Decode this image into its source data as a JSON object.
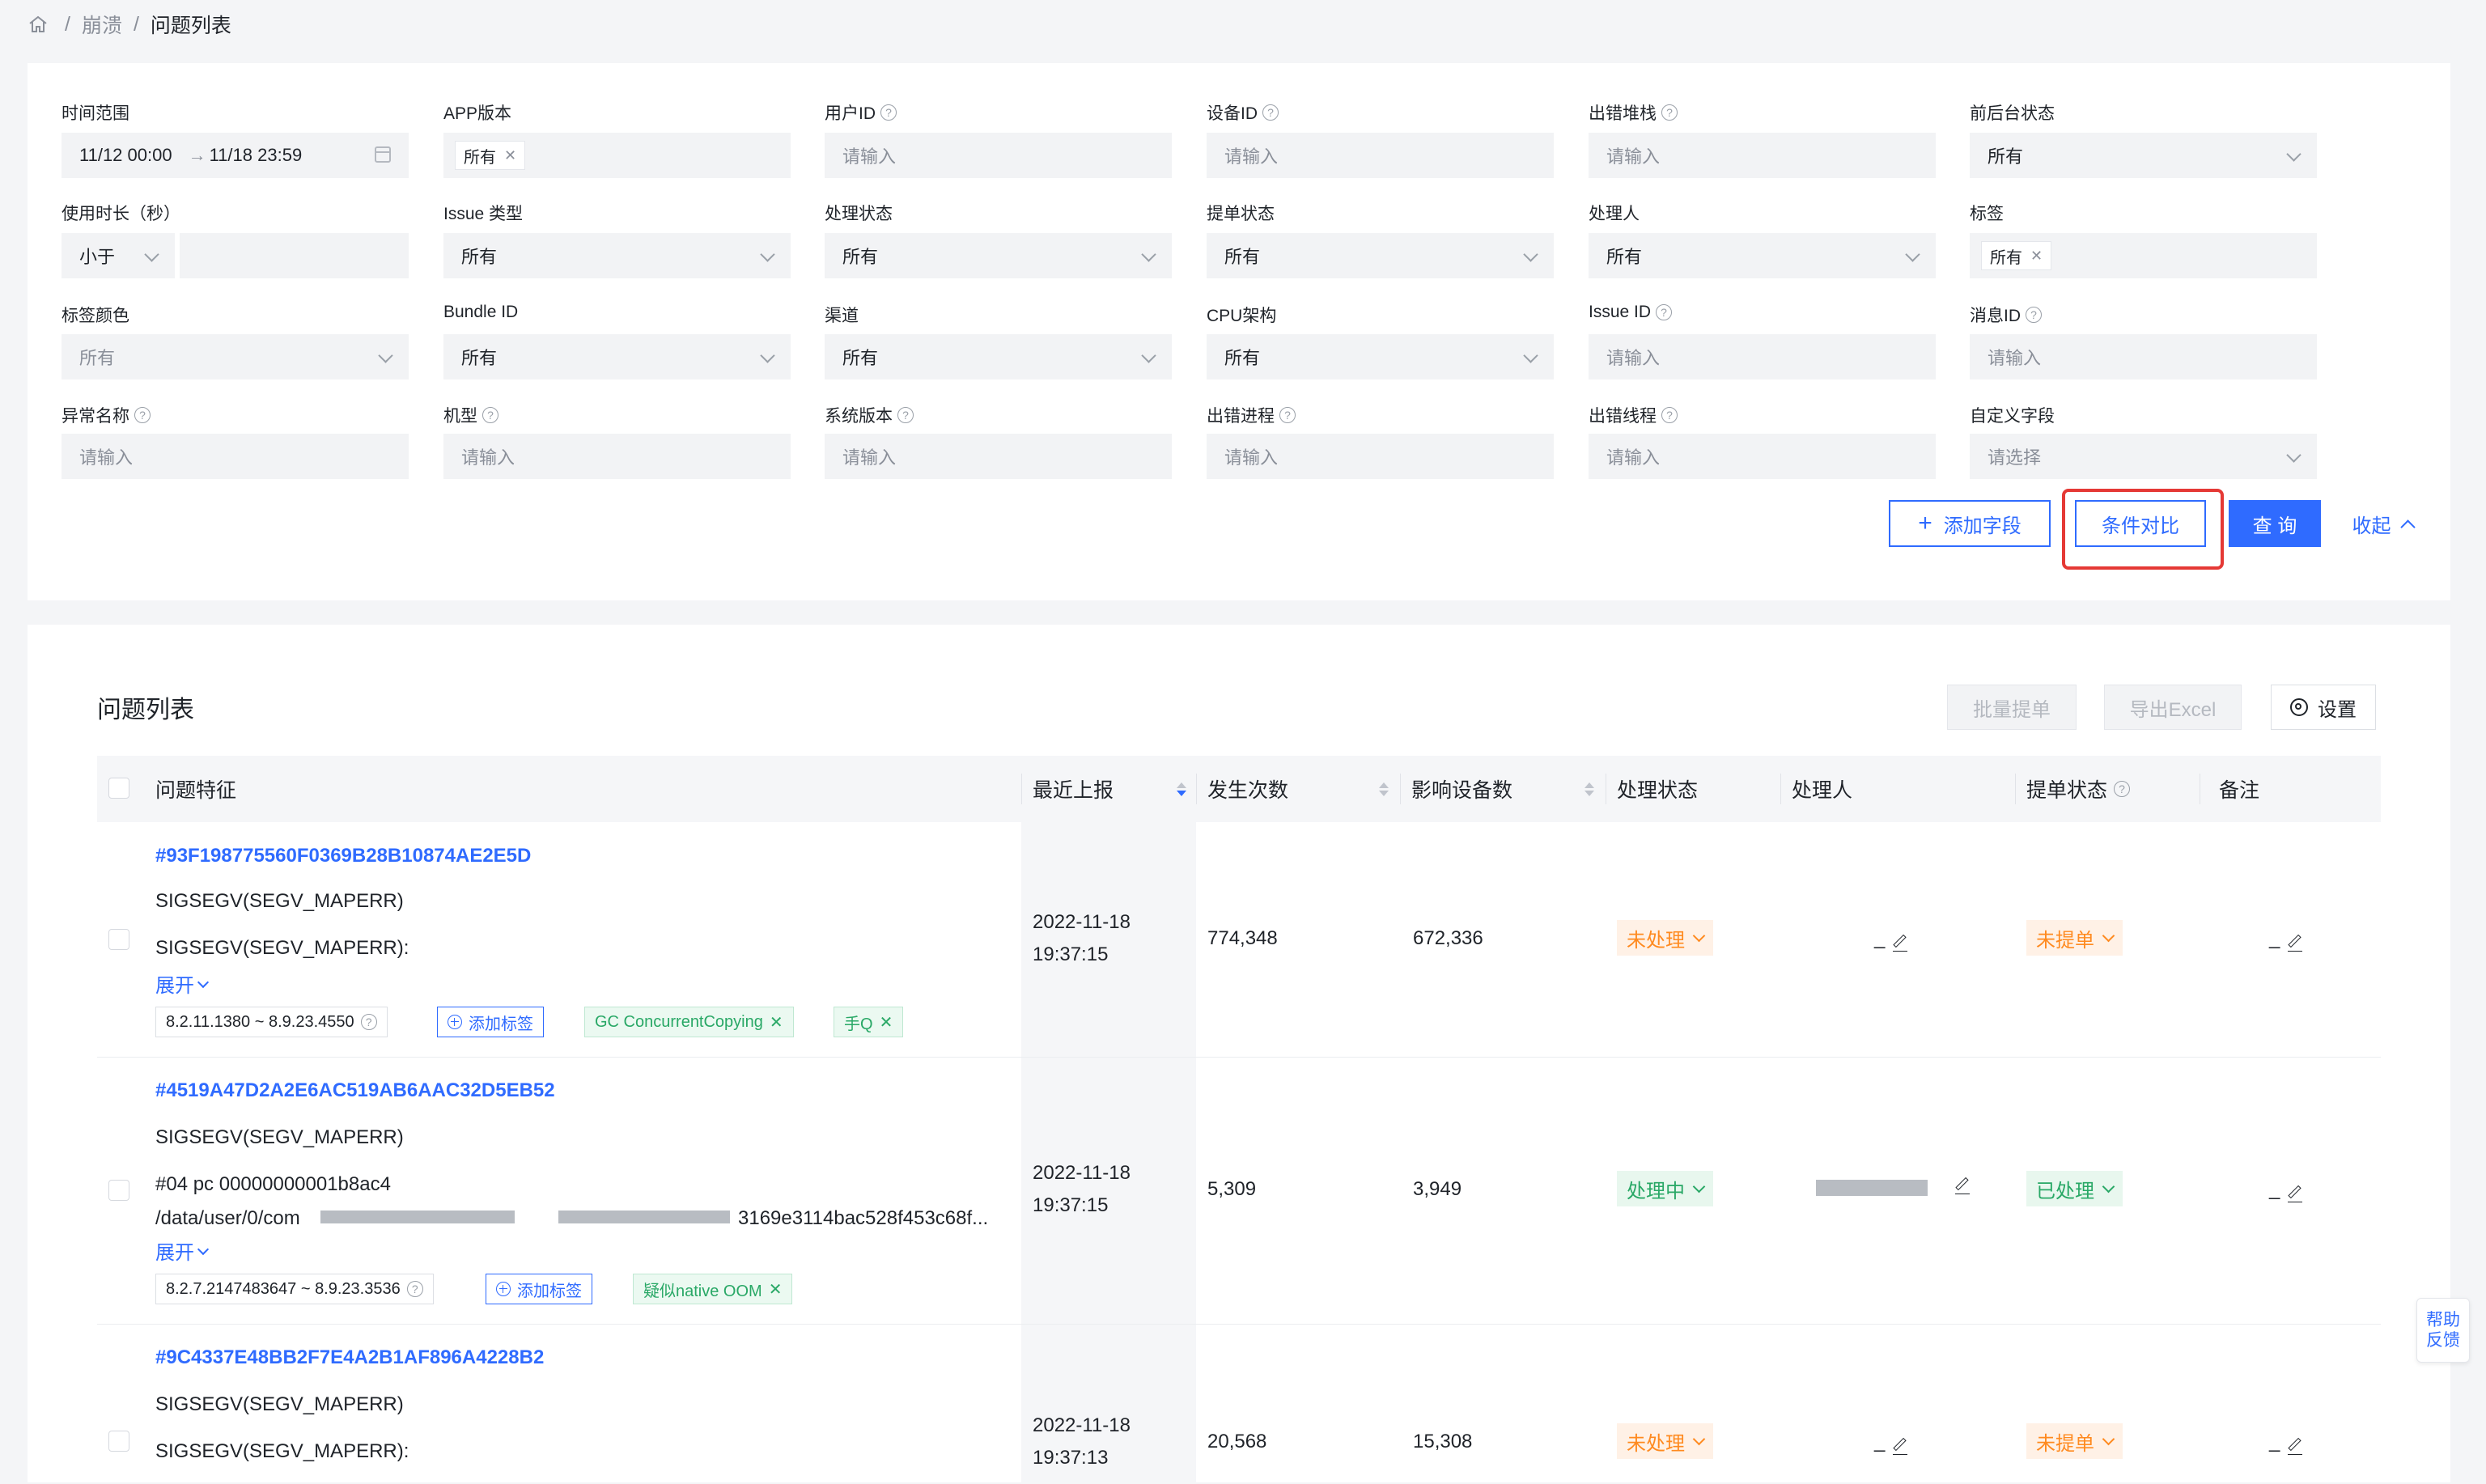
{
  "breadcrumb": {
    "home_icon": "home-icon",
    "items": [
      "崩溃",
      "问题列表"
    ],
    "separator": "/"
  },
  "filters": {
    "time_range": {
      "label": "时间范围",
      "start": "11/12 00:00",
      "arrow": "→",
      "end": "11/18 23:59"
    },
    "app_version": {
      "label": "APP版本",
      "tag": "所有"
    },
    "user_id": {
      "label": "用户ID",
      "placeholder": "请输入"
    },
    "device_id": {
      "label": "设备ID",
      "placeholder": "请输入"
    },
    "error_stack": {
      "label": "出错堆栈",
      "placeholder": "请输入"
    },
    "fg_bg_state": {
      "label": "前后台状态",
      "value": "所有"
    },
    "duration": {
      "label": "使用时长（秒）",
      "operator": "小于"
    },
    "issue_type": {
      "label": "Issue 类型",
      "value": "所有"
    },
    "process_status": {
      "label": "处理状态",
      "value": "所有"
    },
    "ticket_status": {
      "label": "提单状态",
      "value": "所有"
    },
    "handler": {
      "label": "处理人",
      "value": "所有"
    },
    "tags": {
      "label": "标签",
      "tag": "所有"
    },
    "tag_color": {
      "label": "标签颜色",
      "value": "所有"
    },
    "bundle_id": {
      "label": "Bundle ID",
      "value": "所有"
    },
    "channel": {
      "label": "渠道",
      "value": "所有"
    },
    "cpu_arch": {
      "label": "CPU架构",
      "value": "所有"
    },
    "issue_id": {
      "label": "Issue ID",
      "placeholder": "请输入"
    },
    "message_id": {
      "label": "消息ID",
      "placeholder": "请输入"
    },
    "exception_name": {
      "label": "异常名称",
      "placeholder": "请输入"
    },
    "device_model": {
      "label": "机型",
      "placeholder": "请输入"
    },
    "os_version": {
      "label": "系统版本",
      "placeholder": "请输入"
    },
    "error_process": {
      "label": "出错进程",
      "placeholder": "请输入"
    },
    "error_thread": {
      "label": "出错线程",
      "placeholder": "请输入"
    },
    "custom_field": {
      "label": "自定义字段",
      "placeholder": "请选择"
    }
  },
  "filter_actions": {
    "add_field": "添加字段",
    "compare": "条件对比",
    "query": "查 询",
    "collapse": "收起"
  },
  "list": {
    "title": "问题列表",
    "batch_ticket": "批量提单",
    "export_excel": "导出Excel",
    "settings": "设置",
    "columns": [
      "问题特征",
      "最近上报",
      "发生次数",
      "影响设备数",
      "处理状态",
      "处理人",
      "提单状态",
      "备注"
    ],
    "expand_label": "展开",
    "add_tag_label": "添加标签",
    "rows": [
      {
        "issue_id": "#93F198775560F0369B28B10874AE2E5D",
        "title": "SIGSEGV(SEGV_MAPERR)",
        "detail1": "SIGSEGV(SEGV_MAPERR):",
        "detail2": "",
        "version_range": "8.2.11.1380 ~ 8.9.23.4550",
        "tags": [
          "GC ConcurrentCopying",
          "手Q"
        ],
        "last_report_date": "2022-11-18",
        "last_report_time": "19:37:15",
        "occurrences": "774,348",
        "affected_devices": "672,336",
        "process_status": "未处理",
        "handler": "_",
        "ticket_status": "未提单",
        "note": "_"
      },
      {
        "issue_id": "#4519A47D2A2E6AC519AB6AAC32D5EB52",
        "title": "SIGSEGV(SEGV_MAPERR)",
        "detail1": "#04 pc 00000000001b8ac4",
        "detail2": "/data/user/0/com",
        "detail2_tail": "3169e3114bac528f453c68f...",
        "version_range": "8.2.7.2147483647 ~ 8.9.23.3536",
        "tags": [
          "疑似native OOM"
        ],
        "last_report_date": "2022-11-18",
        "last_report_time": "19:37:15",
        "occurrences": "5,309",
        "affected_devices": "3,949",
        "process_status": "处理中",
        "handler": "",
        "ticket_status": "已处理",
        "note": "_"
      },
      {
        "issue_id": "#9C4337E48BB2F7E4A2B1AF896A4228B2",
        "title": "SIGSEGV(SEGV_MAPERR)",
        "detail1": "SIGSEGV(SEGV_MAPERR):",
        "last_report_date": "2022-11-18",
        "last_report_time": "19:37:13",
        "occurrences": "20,568",
        "affected_devices": "15,308",
        "process_status": "未处理",
        "handler": "_",
        "ticket_status": "未提单",
        "note": "_"
      }
    ]
  },
  "help": {
    "line1": "帮助",
    "line2": "反馈"
  },
  "colors": {
    "primary": "#2f6bff",
    "highlight": "#e53935",
    "orange": "#ff8a1f",
    "green": "#29a866"
  }
}
